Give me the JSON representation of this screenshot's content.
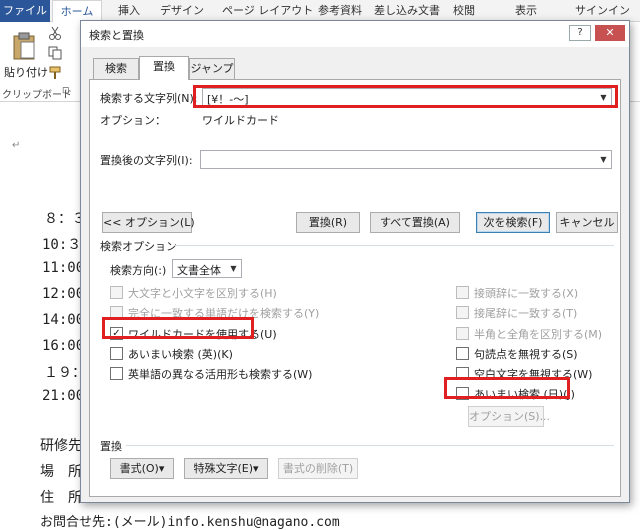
{
  "ribbon": {
    "tabs": [
      "ファイル",
      "ホーム",
      "挿入",
      "デザイン",
      "ページ レイアウト",
      "参考資料",
      "差し込み文書",
      "校閲",
      "表示",
      "サインイン"
    ],
    "paste_label": "貼り付け",
    "clipboard_label": "クリップボード",
    "launcher_glyph": "⊡"
  },
  "document": {
    "lines": [
      "８：３",
      "10:３",
      "11:00",
      "12:00",
      "14:00",
      "16:00",
      "１９：",
      "21:00",
      "研修先",
      "場　所",
      "住　所",
      "お問合せ先:(メール)info.kenshu@nagano.com"
    ],
    "para_mark": "↵"
  },
  "dialog": {
    "title": "検索と置換",
    "help_label": "?",
    "close_label": "✕",
    "tabs": [
      "検索",
      "置換",
      "ジャンプ"
    ],
    "find_label": "検索する文字列(N):",
    "find_value": "[¥！-～]",
    "option_label": "オプション：",
    "option_value": "ワイルドカード",
    "replace_label": "置換後の文字列(I):",
    "replace_value": "",
    "buttons": {
      "less_options": "<< オプション(L)",
      "replace": "置換(R)",
      "replace_all": "すべて置換(A)",
      "find_next": "次を検索(F)",
      "cancel": "キャンセル"
    },
    "search_options_title": "検索オプション",
    "direction_label": "検索方向(:)",
    "direction_value": "文書全体",
    "left_options": [
      {
        "label": "大文字と小文字を区別する(H)",
        "checked": false,
        "disabled": true
      },
      {
        "label": "完全に一致する単語だけを検索する(Y)",
        "checked": false,
        "disabled": true
      },
      {
        "label": "ワイルドカードを使用する(U)",
        "checked": true,
        "disabled": false
      },
      {
        "label": "あいまい検索 (英)(K)",
        "checked": false,
        "disabled": false
      },
      {
        "label": "英単語の異なる活用形も検索する(W)",
        "checked": false,
        "disabled": false
      }
    ],
    "right_options": [
      {
        "label": "接頭辞に一致する(X)",
        "checked": false,
        "disabled": true
      },
      {
        "label": "接尾辞に一致する(T)",
        "checked": false,
        "disabled": true
      },
      {
        "label": "半角と全角を区別する(M)",
        "checked": false,
        "disabled": true
      },
      {
        "label": "句読点を無視する(S)",
        "checked": false,
        "disabled": false
      },
      {
        "label": "空白文字を無視する(W)",
        "checked": false,
        "disabled": false
      },
      {
        "label": "あいまい検索 (日)(J)",
        "checked": false,
        "disabled": false
      }
    ],
    "fuzzy_options_button": "オプション(S)...",
    "replace_section_title": "置換",
    "format_button": "書式(O)▾",
    "special_button": "特殊文字(E)▾",
    "clear_format_button": "書式の削除(T)",
    "check_glyph": "✓",
    "dropdown_glyph": "▼"
  },
  "colors": {
    "file_tab": "#2b579a",
    "highlight": "#e02020",
    "close_button": "#c75050"
  }
}
